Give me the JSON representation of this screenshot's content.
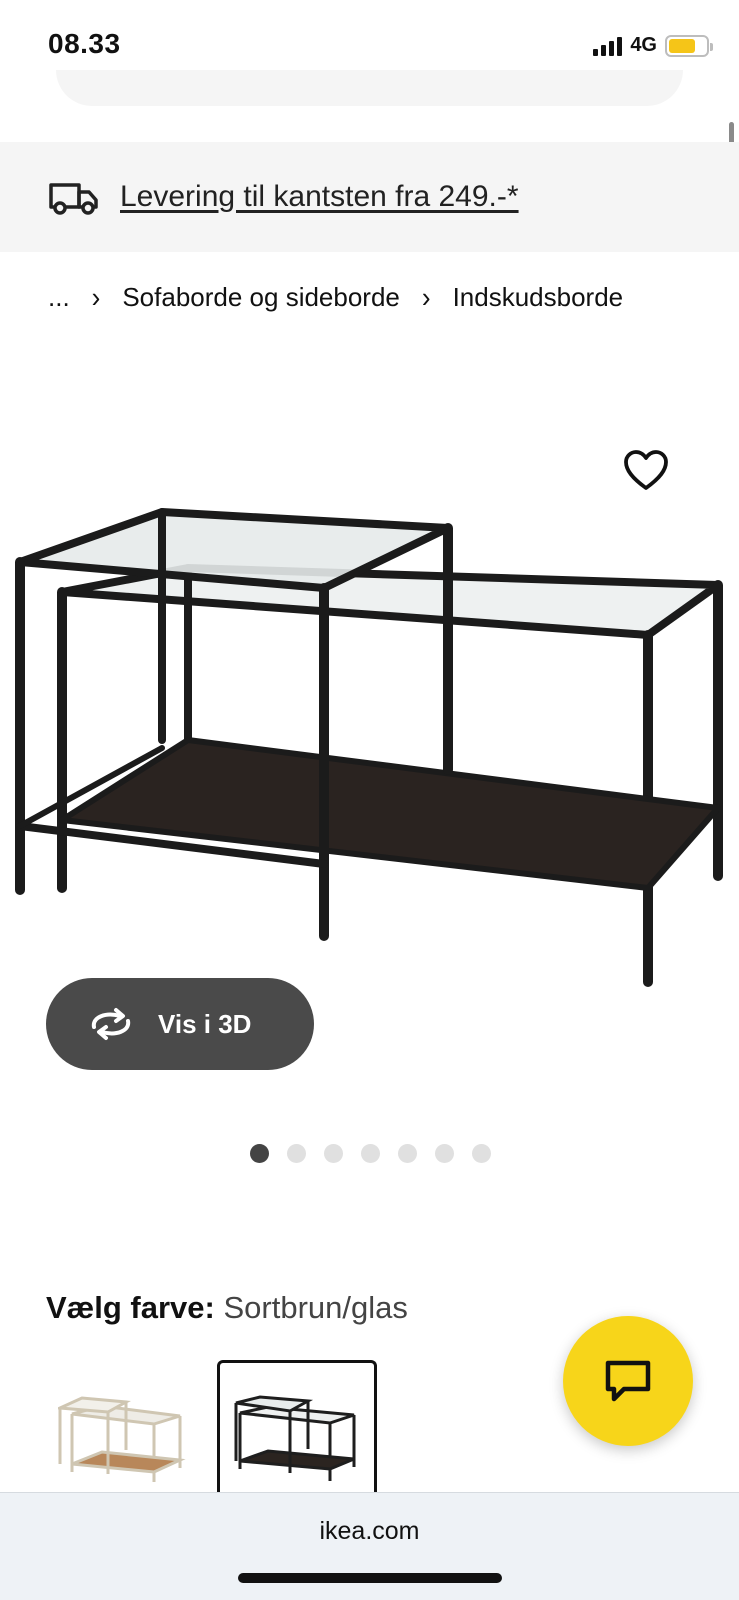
{
  "status_bar": {
    "time": "08.33",
    "network": "4G",
    "battery_color": "#f5c518"
  },
  "delivery_banner": {
    "icon": "truck-icon",
    "text": "Levering til kantsten fra 249.-*"
  },
  "breadcrumb": {
    "items": [
      "...",
      "Sofaborde og sideborde",
      "Indskudsborde"
    ],
    "separator_icon": "chevron-right-icon"
  },
  "product": {
    "image_description_icon": "nesting-tables-image",
    "favorite_icon": "heart-outline-icon",
    "view3d_label": "Vis i 3D",
    "view3d_icon": "rotate-3d-icon",
    "carousel": {
      "count": 7,
      "active_index": 0
    }
  },
  "color_selector": {
    "label": "Vælg farve:",
    "value": "Sortbrun/glas",
    "swatches": [
      {
        "name": "white-stain-variant",
        "selected": false
      },
      {
        "name": "black-brown-glass-variant",
        "selected": true
      }
    ]
  },
  "chat": {
    "icon": "chat-bubble-icon",
    "color": "#f7d51a"
  },
  "browser": {
    "url": "ikea.com"
  }
}
